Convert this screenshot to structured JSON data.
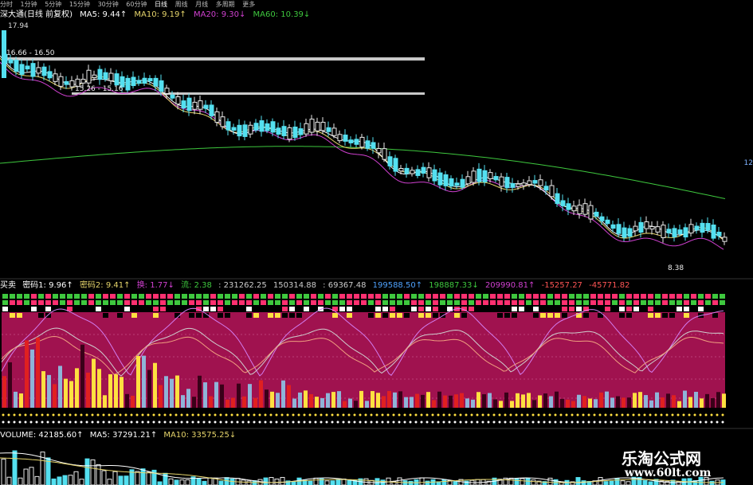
{
  "toolbar": {
    "items": [
      "分时",
      "1分钟",
      "5分钟",
      "15分钟",
      "30分钟",
      "60分钟",
      "日线",
      "周线",
      "月线",
      "多周期",
      "更多"
    ]
  },
  "title": {
    "stock": "深大通(日线 前复权)",
    "ma5": "MA5: 9.44↑",
    "ma10": "MA10: 9.19↑",
    "ma20": "MA20: 9.30↓",
    "ma60": "MA60: 10.39↓"
  },
  "price_labels": {
    "high": "17.94",
    "range1": "16.66 - 16.50",
    "range2": "15.26 - 15.16",
    "low": "8.38"
  },
  "indicator": {
    "name": "买卖",
    "v1": "密码1: 9.96↑",
    "v2": "密码2: 9.41↑",
    "v3": "换: 1.77↓",
    "v4": "流: 2.38",
    "v5": ": 231262.25",
    "v6": "150314.88",
    "v7": ": 69367.48",
    "v8": "199588.50↑",
    "v9": "198887.33↓",
    "v10": "209990.81↑",
    "v11": "-15257.27",
    "v12": "-45771.82"
  },
  "volume": {
    "name": "VOLUME: 42185.60↑",
    "ma5": "MA5: 37291.21↑",
    "ma10": "MA10: 33575.25↓"
  },
  "watermark": {
    "cn": "乐淘公式网",
    "url": "www.60lt.com"
  },
  "colors": {
    "up": "#e8e8e8",
    "down": "#54e0f0",
    "ma5": "#ffffff",
    "ma10": "#e6d56b",
    "ma20": "#d040d0",
    "ma60": "#3ec83e",
    "panel_bg": "#a0124f"
  }
}
